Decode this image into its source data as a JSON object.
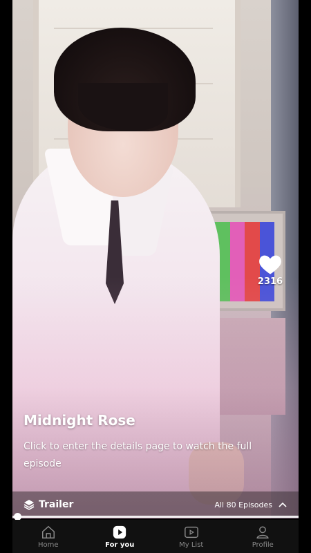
{
  "video": {
    "show_title": "Midnight Rose",
    "description": "Click to enter the details page to watch the full episode"
  },
  "likes": {
    "count": "2316",
    "icon": "heart-icon"
  },
  "trailer_bar": {
    "label": "Trailer",
    "icon": "layers-icon",
    "episodes_label": "All 80 Episodes",
    "expand_icon": "chevron-up-icon"
  },
  "playback": {
    "progress": 0.0
  },
  "tabs": [
    {
      "label": "Home",
      "icon": "home-icon",
      "active": false
    },
    {
      "label": "For you",
      "icon": "play-icon",
      "active": true
    },
    {
      "label": "My List",
      "icon": "video-list-icon",
      "active": false
    },
    {
      "label": "Profile",
      "icon": "profile-icon",
      "active": false
    }
  ],
  "colors": {
    "background": "#000000",
    "tabbar": "#111111",
    "active_tab": "#ffffff",
    "inactive_tab": "#8a8a8a"
  }
}
